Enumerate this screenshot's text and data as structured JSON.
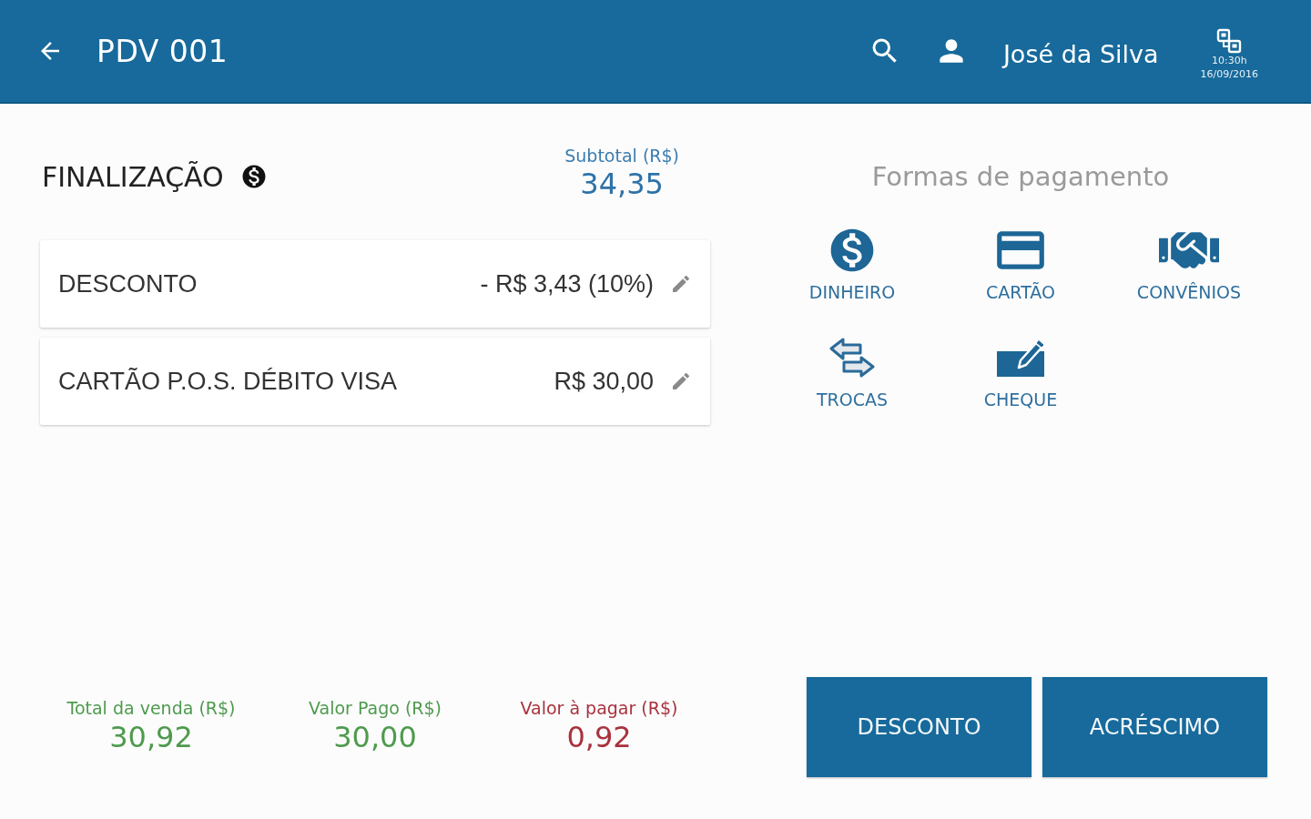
{
  "header": {
    "title": "PDV 001",
    "user": "José da Silva",
    "time": "10:30h",
    "date": "16/09/2016"
  },
  "finalization": {
    "title": "FINALIZAÇÃO",
    "subtotal": {
      "label": "Subtotal (R$)",
      "value": "34,35"
    },
    "entries": [
      {
        "label": "DESCONTO",
        "amount": "- R$ 3,43 (10%)"
      },
      {
        "label": "CARTÃO P.O.S. DÉBITO VISA",
        "amount": "R$ 30,00"
      }
    ]
  },
  "payment_methods": {
    "title": "Formas de pagamento",
    "items": [
      {
        "kind": "cash",
        "label": "DINHEIRO"
      },
      {
        "kind": "card",
        "label": "CARTÃO"
      },
      {
        "kind": "agreement",
        "label": "CONVÊNIOS"
      },
      {
        "kind": "exchange",
        "label": "TROCAS"
      },
      {
        "kind": "check",
        "label": "CHEQUE"
      }
    ]
  },
  "totals": [
    {
      "label": "Total da venda (R$)",
      "value": "30,92",
      "color": "#4e9a4e"
    },
    {
      "label": "Valor Pago (R$)",
      "value": "30,00",
      "color": "#4e9a4e"
    },
    {
      "label": "Valor à pagar (R$)",
      "value": "0,92",
      "color": "#a8323e"
    }
  ],
  "actions": [
    "DESCONTO",
    "ACRÉSCIMO"
  ]
}
